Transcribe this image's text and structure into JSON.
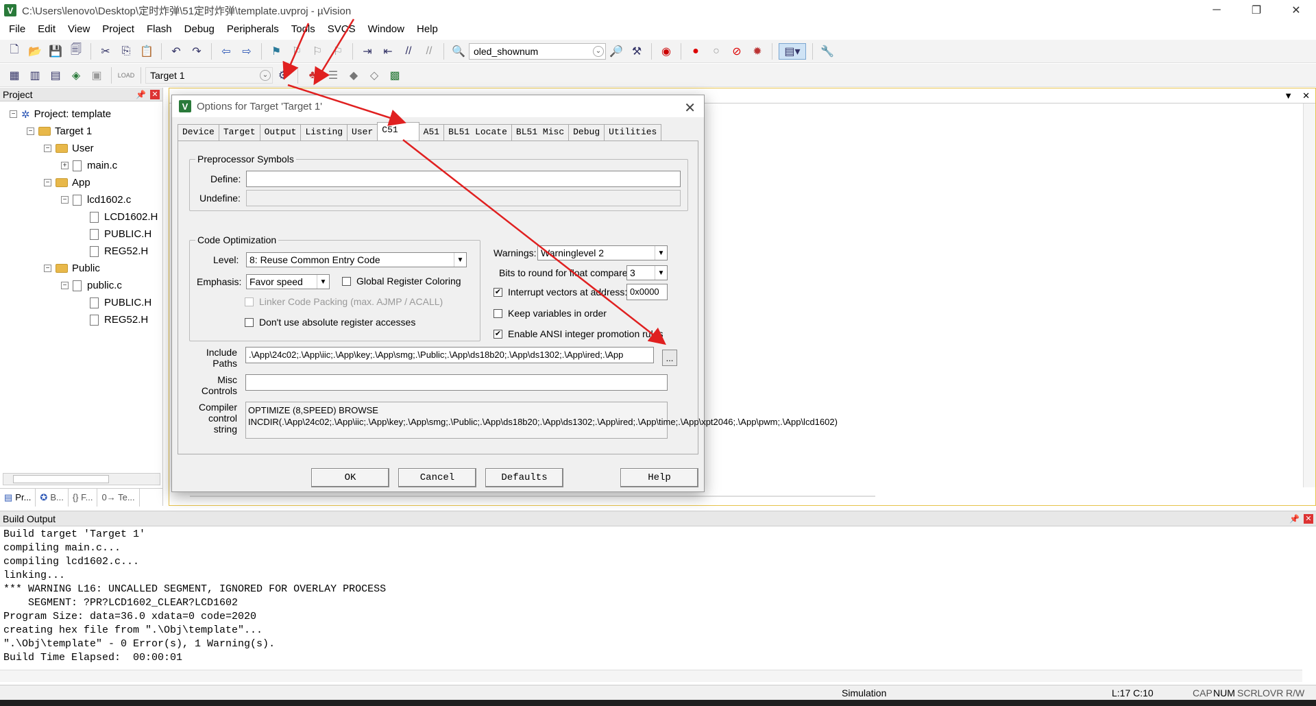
{
  "window": {
    "title": "C:\\Users\\lenovo\\Desktop\\定时炸弹\\51定时炸弹\\template.uvproj - µVision",
    "minimize": "─",
    "maximize": "❐",
    "close": "✕"
  },
  "menu": [
    "File",
    "Edit",
    "View",
    "Project",
    "Flash",
    "Debug",
    "Peripherals",
    "Tools",
    "SVCS",
    "Window",
    "Help"
  ],
  "toolbar": {
    "find_combo_value": "oled_shownum",
    "target_combo_value": "Target 1"
  },
  "project_panel": {
    "header": "Project",
    "tree": [
      {
        "label": "Project: template",
        "level": 0,
        "kind": "project",
        "expander": "−"
      },
      {
        "label": "Target 1",
        "level": 1,
        "kind": "target",
        "expander": "−"
      },
      {
        "label": "User",
        "level": 2,
        "kind": "folder",
        "expander": "−"
      },
      {
        "label": "main.c",
        "level": 3,
        "kind": "file",
        "expander": "+"
      },
      {
        "label": "App",
        "level": 2,
        "kind": "folder",
        "expander": "−"
      },
      {
        "label": "lcd1602.c",
        "level": 3,
        "kind": "file",
        "expander": "−"
      },
      {
        "label": "LCD1602.H",
        "level": 4,
        "kind": "file",
        "expander": ""
      },
      {
        "label": "PUBLIC.H",
        "level": 4,
        "kind": "file",
        "expander": ""
      },
      {
        "label": "REG52.H",
        "level": 4,
        "kind": "file",
        "expander": ""
      },
      {
        "label": "Public",
        "level": 2,
        "kind": "folder",
        "expander": "−"
      },
      {
        "label": "public.c",
        "level": 3,
        "kind": "file",
        "expander": "−"
      },
      {
        "label": "PUBLIC.H",
        "level": 4,
        "kind": "file",
        "expander": ""
      },
      {
        "label": "REG52.H",
        "level": 4,
        "kind": "file",
        "expander": ""
      }
    ],
    "tabs": [
      "Pr...",
      "B...",
      "{} F...",
      "0→ Te..."
    ]
  },
  "dialog": {
    "title": "Options for Target 'Target 1'",
    "tabs": [
      "Device",
      "Target",
      "Output",
      "Listing",
      "User",
      "C51",
      "A51",
      "BL51 Locate",
      "BL51 Misc",
      "Debug",
      "Utilities"
    ],
    "active_tab": "C51",
    "preprocessor": {
      "group_label": "Preprocessor Symbols",
      "define_label": "Define:",
      "define_value": "",
      "undefine_label": "Undefine:",
      "undefine_value": ""
    },
    "optimization": {
      "group_label": "Code Optimization",
      "level_label": "Level:",
      "level_value": "8: Reuse Common Entry Code",
      "emphasis_label": "Emphasis:",
      "emphasis_value": "Favor speed",
      "global_reg_label": "Global Register Coloring",
      "global_reg_checked": false,
      "linker_packing_label": "Linker Code Packing (max. AJMP / ACALL)",
      "linker_packing_checked": false,
      "no_abs_label": "Don't use absolute register accesses",
      "no_abs_checked": false
    },
    "warnings_label": "Warnings:",
    "warnings_value": "Warninglevel 2",
    "float_label": "Bits to round for float compare:",
    "float_value": "3",
    "interrupt_label": "Interrupt vectors at address:",
    "interrupt_checked": true,
    "interrupt_value": "0x0000",
    "keep_vars_label": "Keep variables in order",
    "keep_vars_checked": false,
    "ansi_label": "Enable ANSI integer promotion rules",
    "ansi_checked": true,
    "include_label": "Include\nPaths",
    "include_value": ".\\App\\24c02;.\\App\\iic;.\\App\\key;.\\App\\smg;.\\Public;.\\App\\ds18b20;.\\App\\ds1302;.\\App\\ired;.\\App",
    "browse_label": "...",
    "misc_label": "Misc\nControls",
    "misc_value": "",
    "compiler_label": "Compiler\ncontrol\nstring",
    "compiler_value": "OPTIMIZE (8,SPEED) BROWSE INCDIR(.\\App\\24c02;.\\App\\iic;.\\App\\key;.\\App\\smg;.\\Public;.\\App\\ds18b20;.\\App\\ds1302;.\\App\\ired;.\\App\\time;.\\App\\xpt2046;.\\App\\pwm;.\\App\\lcd1602)",
    "buttons": {
      "ok": "OK",
      "cancel": "Cancel",
      "defaults": "Defaults",
      "help": "Help"
    }
  },
  "build_output": {
    "header": "Build Output",
    "lines": "Build target 'Target 1'\ncompiling main.c...\ncompiling lcd1602.c...\nlinking...\n*** WARNING L16: UNCALLED SEGMENT, IGNORED FOR OVERLAY PROCESS\n    SEGMENT: ?PR?LCD1602_CLEAR?LCD1602\nProgram Size: data=36.0 xdata=0 code=2020\ncreating hex file from \".\\Obj\\template\"...\n\".\\Obj\\template\" - 0 Error(s), 1 Warning(s).\nBuild Time Elapsed:  00:00:01"
  },
  "statusbar": {
    "mode": "Simulation",
    "position": "L:17 C:10",
    "cap": "CAP",
    "num": "NUM",
    "scrl": "SCRL",
    "ovr": "OVR",
    "rw": "R/W"
  },
  "colors": {
    "annotation_arrow": "#e02020",
    "editor_border": "#e6c24a"
  }
}
